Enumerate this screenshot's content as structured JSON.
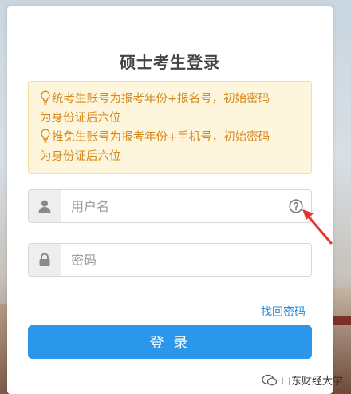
{
  "page": {
    "title": "硕士考生登录"
  },
  "notice": {
    "line1": "统考生账号为报考年份+报名号，初始密码",
    "line2": "为身份证后六位",
    "line3": "推免生账号为报考年份+手机号，初始密码",
    "line4": "为身份证后六位",
    "icon": "lightbulb-icon"
  },
  "username": {
    "placeholder": "用户名",
    "value": "",
    "icon": "user-icon",
    "help_icon": "question-circle-icon"
  },
  "password": {
    "placeholder": "密码",
    "value": "",
    "icon": "lock-icon"
  },
  "links": {
    "forgot_password": "找回密码"
  },
  "buttons": {
    "login": "登 录"
  },
  "watermark": {
    "text": "山东财经大学",
    "icon": "wechat-icon"
  },
  "colors": {
    "accent": "#2b97eb",
    "notice_text": "#d8881b",
    "notice_bg": "#fdf6dc",
    "annotation_arrow": "#e8322c"
  }
}
